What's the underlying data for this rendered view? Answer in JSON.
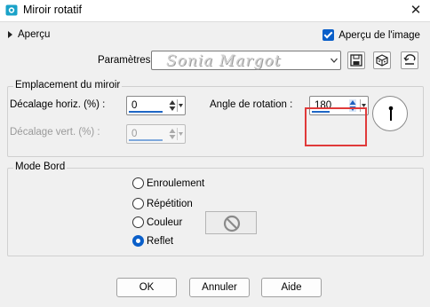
{
  "window": {
    "title": "Miroir rotatif",
    "app_icon": "psp-app-icon",
    "close_icon": "close-icon",
    "close_glyph": "✕"
  },
  "preview": {
    "toggle_label": "Aperçu",
    "show_image_label": "Aperçu de l'image",
    "show_image_checked": true
  },
  "presets": {
    "label": "Paramètres :",
    "watermark": "Sonia Margot",
    "tool_icons": [
      "save-icon",
      "cube-icon",
      "reset-icon"
    ]
  },
  "mirror_location": {
    "title": "Emplacement du miroir",
    "horizontal_offset_label": "Décalage horiz. (%) :",
    "horizontal_offset_value": "0",
    "vertical_offset_label": "Décalage vert. (%) :",
    "vertical_offset_value": "0",
    "vertical_offset_enabled": false,
    "rotation_angle_label": "Angle de rotation :",
    "rotation_angle_value": "180"
  },
  "edge_mode": {
    "title": "Mode Bord",
    "options": [
      "Enroulement",
      "Répétition",
      "Couleur",
      "Reflet"
    ],
    "selected": "Reflet",
    "color_icon": "no-color-icon"
  },
  "buttons": {
    "ok": "OK",
    "cancel": "Annuler",
    "help": "Aide"
  },
  "colors": {
    "accent": "#0a5fc9",
    "highlight_box": "#e03a3a",
    "dialog_bg": "#f0f0f0"
  }
}
